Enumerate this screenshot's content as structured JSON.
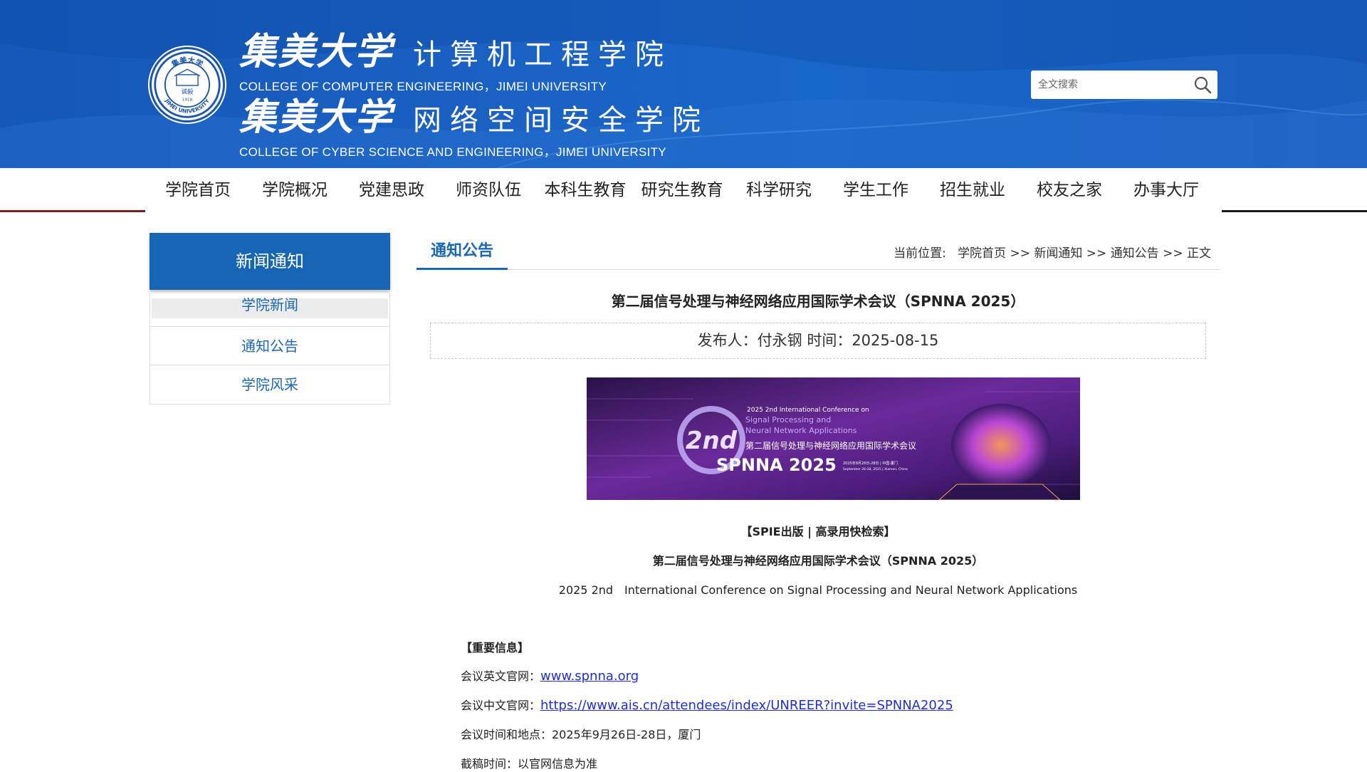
{
  "header": {
    "brand1_cn_uni": "集美大学",
    "brand1_cn_college": "计算机工程学院",
    "brand1_en": "COLLEGE  OF COMPUTER ENGINEERING，JIMEI UNIVERSITY",
    "brand2_cn_uni": "集美大学",
    "brand2_cn_college": "网络空间安全学院",
    "brand2_en": "COLLEGE OF CYBER SCIENCE AND ENGINEERING，JIMEI UNIVERSITY",
    "seal_text_top": "集美大学",
    "seal_text_bottom": "JIMEI UNIVERSITY",
    "seal_motto": "诚毅",
    "seal_year": "1918"
  },
  "search": {
    "placeholder": "全文搜索"
  },
  "nav": {
    "items": [
      "学院首页",
      "学院概况",
      "党建思政",
      "师资队伍",
      "本科生教育",
      "研究生教育",
      "科学研究",
      "学生工作",
      "招生就业",
      "校友之家",
      "办事大厅"
    ]
  },
  "sidebar": {
    "title": "新闻通知",
    "items": [
      {
        "label": "学院新闻"
      },
      {
        "label": "通知公告"
      },
      {
        "label": "学院风采"
      }
    ]
  },
  "main": {
    "tab": "通知公告",
    "breadcrumb": {
      "prefix": "当前位置:",
      "items": [
        "学院首页",
        "新闻通知",
        "通知公告",
        "正文"
      ],
      "sep": ">>"
    },
    "title": "第二届信号处理与神经网络应用国际学术会议（SPNNA 2025）",
    "meta": "发布人：付永钢 时间：2025-08-15",
    "hero": {
      "line1": "2025 2nd International Conference on",
      "line2": "Signal Processing and",
      "line3": "Neural Network Applications",
      "line4": "第二届信号处理与神经网络应用国际学术会议",
      "badge": "2nd",
      "brand": "SPNNA 2025",
      "date_cn": "2025年9月26日-28日 | 中国·厦门",
      "date_en": "September 26-28, 2025 | Xiamen, China"
    },
    "body": {
      "spie": "【SPIE出版 | 高录用快检索】",
      "cn_title": "第二届信号处理与神经网络应用国际学术会议（SPNNA 2025）",
      "en_title": "2025 2nd　International Conference on Signal Processing and Neural Network Applications",
      "important": "【重要信息】",
      "en_site_label": "会议英文官网：",
      "en_site_link": "www.spnna.org",
      "cn_site_label": "会议中文官网：",
      "cn_site_link": "https://www.ais.cn/attendees/index/UNREER?invite=SPNNA2025",
      "time_place": "会议时间和地点：2025年9月26日-28日，厦门",
      "deadline": "截稿时间：以官网信息为准"
    }
  },
  "colors": {
    "header_blue": "#1766c9",
    "sidebar_blue": "#1766b5",
    "link_blue": "#1f2fd6",
    "accent_text": "#1a67b2"
  },
  "icons": {
    "search": "magnifier-icon"
  }
}
